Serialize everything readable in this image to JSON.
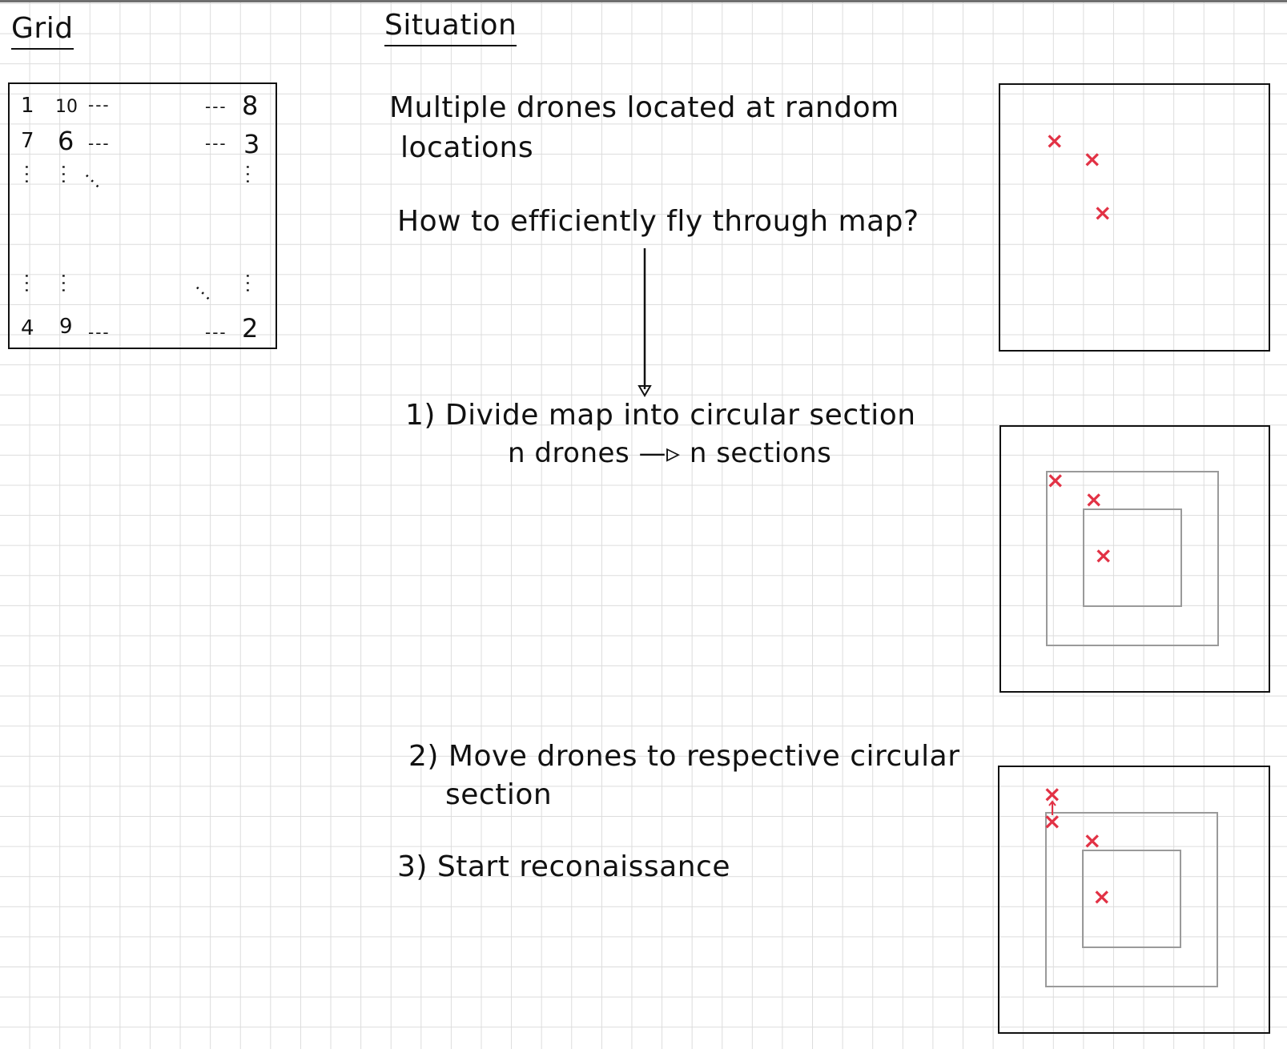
{
  "headings": {
    "grid": "Grid",
    "situation": "Situation"
  },
  "grid_example": {
    "row1": {
      "c1": "1",
      "c2": "10",
      "dots_mid": "---",
      "dots_end": "---",
      "last": "8"
    },
    "row2": {
      "c1": "7",
      "c2": "6",
      "dots_mid": "---",
      "dots_end": "---",
      "last": "3"
    },
    "row_last": {
      "c1": "4",
      "c2": "9",
      "dots_mid": "---",
      "dots_end": "---",
      "last": "2"
    },
    "vdots": "...",
    "diag_dots": "..."
  },
  "notes": {
    "line1": "Multiple drones located at random",
    "line2": "locations",
    "question": "How to efficiently fly through map?",
    "step1_line1": "1) Divide map into circular section",
    "step1_line2": "n drones —▹ n sections",
    "step2_line1": "2) Move drones to respective circular",
    "step2_line2": "section",
    "step3": "3) Start reconaissance"
  },
  "drone_mark": "×",
  "colors": {
    "ink": "#111111",
    "drone": "#e23245",
    "ring": "#9a9a9a",
    "grid": "#dcdcdc"
  }
}
